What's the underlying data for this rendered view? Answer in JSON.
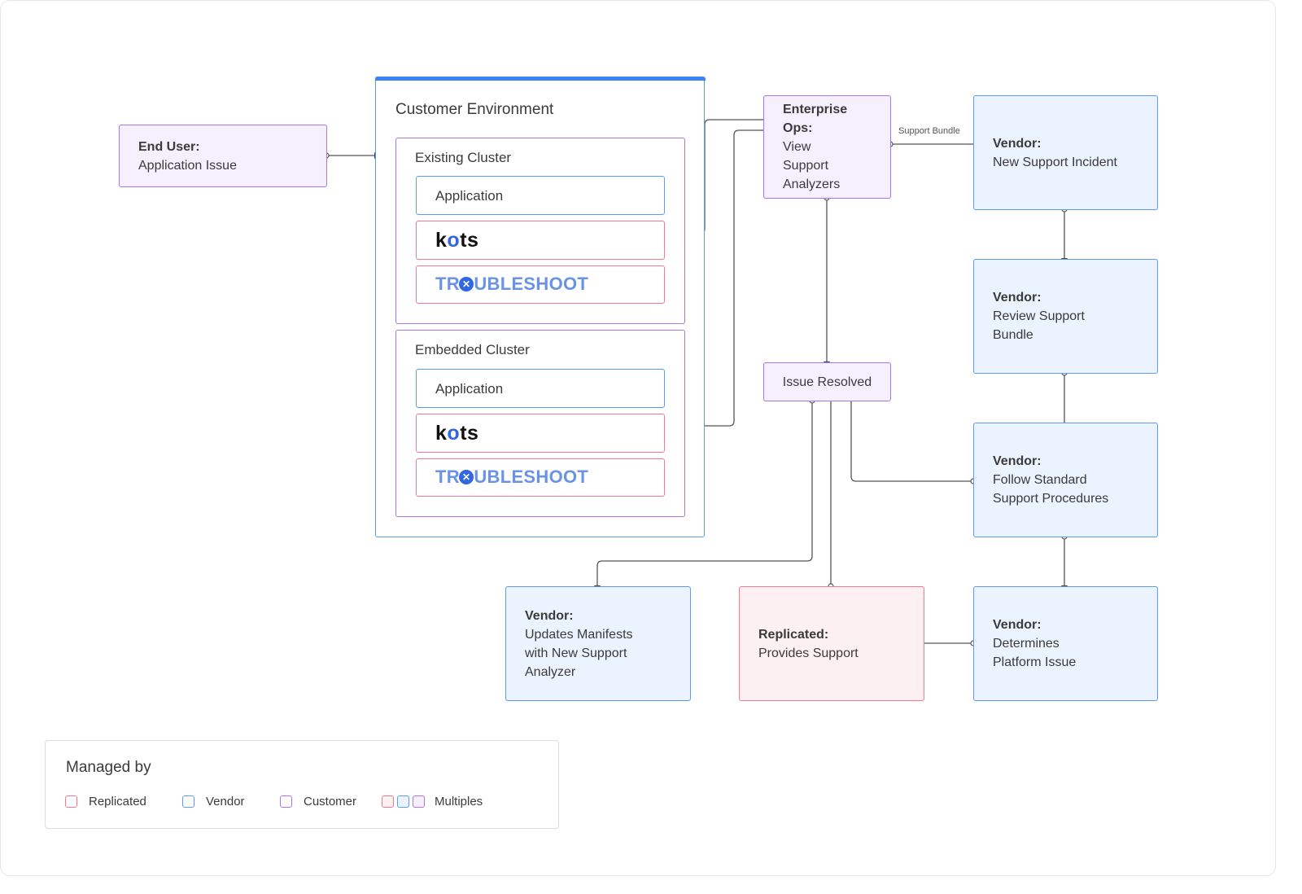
{
  "end_user": {
    "title": "End User:",
    "text": "Application Issue"
  },
  "customer_env": {
    "title": "Customer Environment",
    "existing": {
      "title": "Existing Cluster",
      "app": "Application",
      "kots": "kots",
      "troubleshoot": "TROUBLESHOOT"
    },
    "embedded": {
      "title": "Embedded Cluster",
      "app": "Application",
      "kots": "kots",
      "troubleshoot": "TROUBLESHOOT"
    }
  },
  "enterprise_ops": {
    "title": "Enterprise Ops:",
    "lines": [
      "View",
      "Support",
      "Analyzers"
    ]
  },
  "support_bundle_label": "Support Bundle",
  "issue_resolved": "Issue Resolved",
  "vendor_new": {
    "title": "Vendor:",
    "text": "New Support Incident"
  },
  "vendor_review": {
    "title": "Vendor:",
    "lines": [
      "Review Support",
      "Bundle"
    ]
  },
  "vendor_follow": {
    "title": "Vendor:",
    "lines": [
      "Follow Standard",
      "Support Procedures"
    ]
  },
  "vendor_determines": {
    "title": "Vendor:",
    "lines": [
      "Determines",
      "Platform Issue"
    ]
  },
  "replicated": {
    "title": "Replicated:",
    "text": "Provides Support"
  },
  "vendor_updates": {
    "title": "Vendor:",
    "lines": [
      "Updates Manifests",
      "with New Support",
      "Analyzer"
    ]
  },
  "legend": {
    "title": "Managed by",
    "items": [
      "Replicated",
      "Vendor",
      "Customer",
      "Multiples"
    ]
  },
  "colors": {
    "replicated": "#f07a94",
    "vendor": "#5b9cf0",
    "customer": "#a877f0",
    "accent": "#3b82f6"
  }
}
